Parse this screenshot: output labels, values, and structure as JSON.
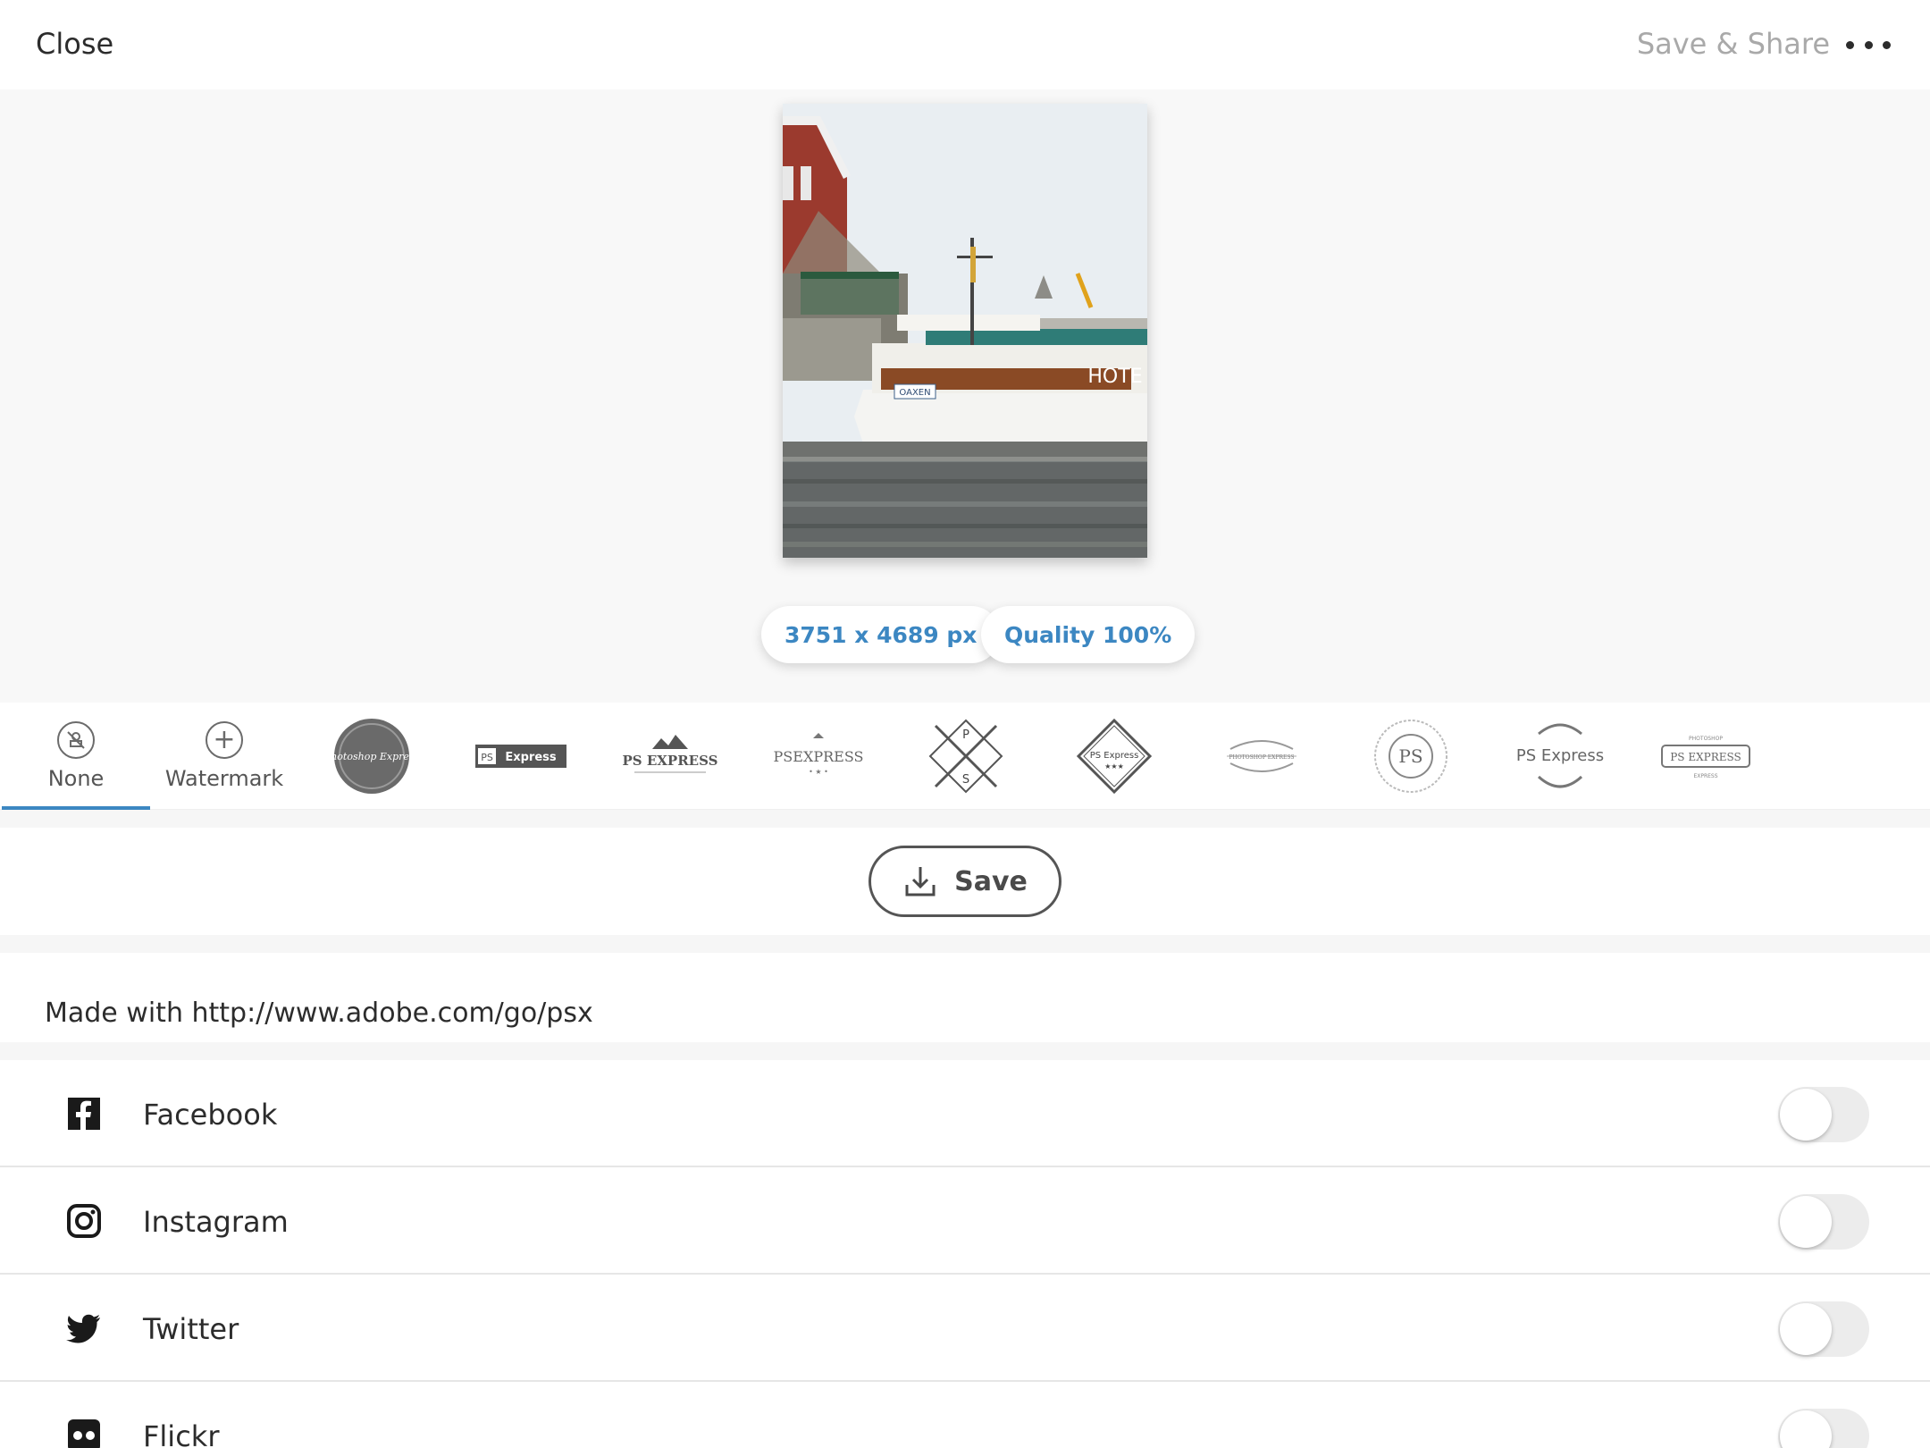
{
  "topbar": {
    "close_label": "Close",
    "save_share_label": "Save & Share",
    "more_icon": "ellipsis-icon"
  },
  "preview": {
    "image_size_label": "3751 x 4689 px",
    "quality_label": "Quality 100%",
    "boat_sign": "OAXEN",
    "hotel_sign": "HOTE"
  },
  "watermarks": {
    "selected": "None",
    "items": [
      {
        "label": "None",
        "icon": "no-watermark-icon"
      },
      {
        "label": "Watermark",
        "icon": "plus-circle-icon"
      },
      {
        "text": "Photoshop Express"
      },
      {
        "text": "Express"
      },
      {
        "text": "PS EXPRESS"
      },
      {
        "text": "PSEXPRESS"
      },
      {
        "text": "P"
      },
      {
        "text": "PS Express"
      },
      {
        "text": "PHOTOSHOP EXPRESS"
      },
      {
        "text": "PS"
      },
      {
        "text": "PS Express"
      },
      {
        "text": "PS EXPRESS"
      }
    ]
  },
  "save": {
    "label": "Save",
    "icon": "download-icon"
  },
  "caption": "Made with http://www.adobe.com/go/psx",
  "share": [
    {
      "name": "Facebook",
      "icon": "facebook-icon",
      "enabled": false
    },
    {
      "name": "Instagram",
      "icon": "instagram-icon",
      "enabled": false
    },
    {
      "name": "Twitter",
      "icon": "twitter-icon",
      "enabled": false
    },
    {
      "name": "Flickr",
      "icon": "flickr-icon",
      "enabled": false
    }
  ],
  "colors": {
    "accent": "#3c87c2",
    "muted": "#a9a9a9",
    "text": "#2c2c2c"
  }
}
